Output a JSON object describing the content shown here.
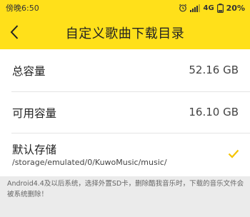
{
  "status_bar": {
    "time": "傍晚6:50",
    "network": "4G",
    "battery": "20%",
    "icons": [
      "alarm-icon",
      "signal-icon",
      "network-4g",
      "battery-icon"
    ]
  },
  "toolbar": {
    "back_icon": "chevron-left-icon",
    "title": "自定义歌曲下载目录"
  },
  "storage": {
    "total_label": "总容量",
    "total_value": "52.16 GB",
    "free_label": "可用容量",
    "free_value": "16.10 GB",
    "default_label": "默认存储",
    "default_path": "/storage/emulated/0/KuwoMusic/music/",
    "default_selected": true
  },
  "footnote": "Android4.4及以后系统，选择外置SD卡，删除酷我音乐时，下载的音乐文件会被系统删除！",
  "colors": {
    "accent": "#ffe01a",
    "check": "#f5c400",
    "background": "#ebebeb"
  }
}
